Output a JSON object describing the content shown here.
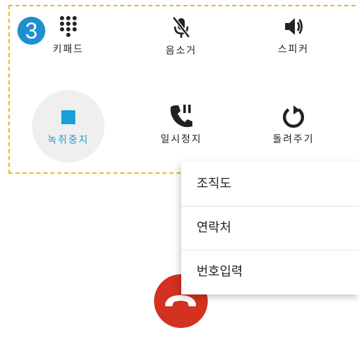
{
  "step_badge": "3",
  "controls": {
    "keypad": {
      "label": "키패드",
      "icon": "keypad-icon"
    },
    "mute": {
      "label": "음소거",
      "icon": "mic-off-icon"
    },
    "speaker": {
      "label": "스피커",
      "icon": "speaker-icon"
    },
    "stop_recording": {
      "label": "녹취중지",
      "icon": "stop-icon"
    },
    "hold": {
      "label": "일시정지",
      "icon": "call-hold-icon"
    },
    "transfer": {
      "label": "돌려주기",
      "icon": "redirect-icon"
    }
  },
  "menu": {
    "items": [
      {
        "label": "조직도"
      },
      {
        "label": "연락처"
      },
      {
        "label": "번호입력"
      }
    ]
  },
  "end_call": {
    "icon": "hangup-icon"
  },
  "colors": {
    "accent": "#1a9fd6",
    "badge": "#1f8fd0",
    "hangup": "#d2321f",
    "highlight_border": "#f3b51c"
  }
}
